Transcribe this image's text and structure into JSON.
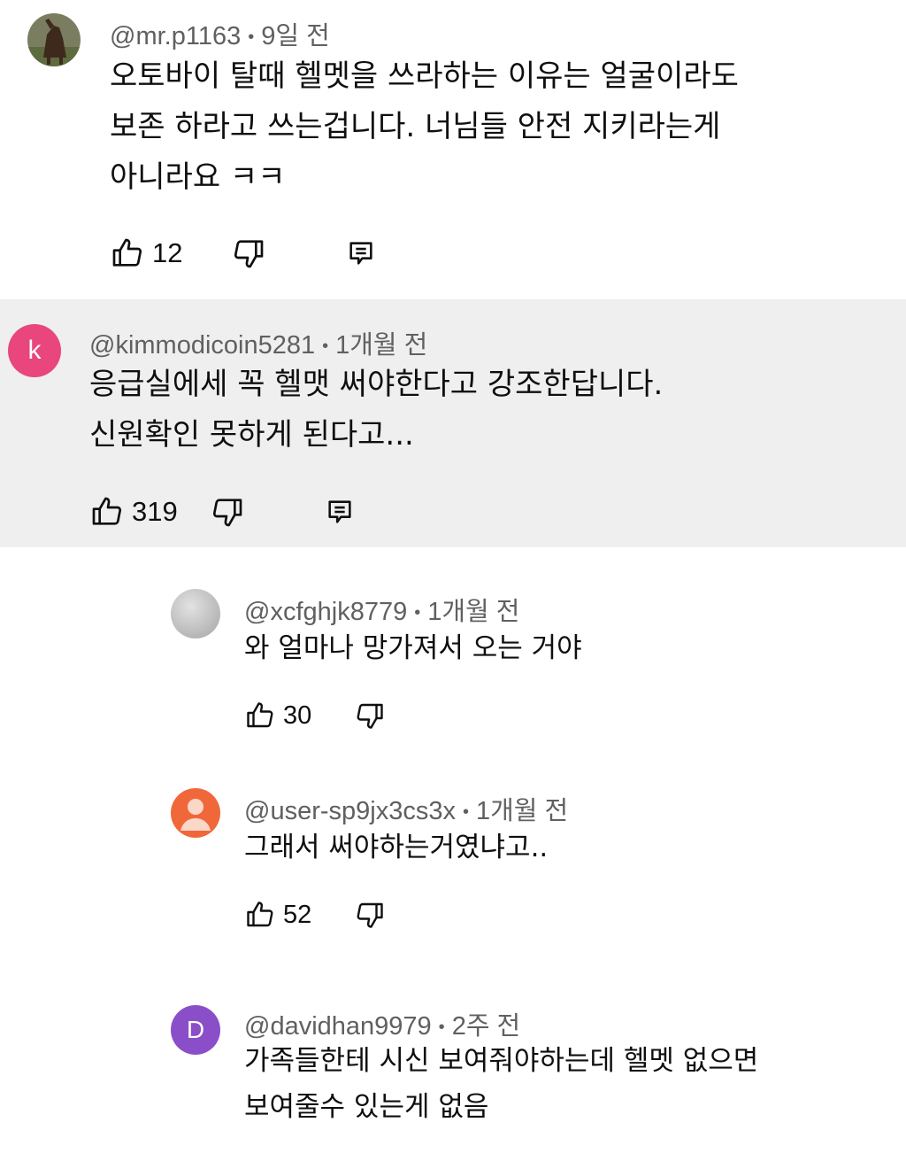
{
  "comments": [
    {
      "author": "@mr.p1163",
      "time": "9일 전",
      "lines": [
        "오토바이 탈때 헬멧을 쓰라하는 이유는 얼굴이라도",
        "보존 하라고 쓰는겁니다. 너님들 안전 지키라는게",
        "아니라요 ㅋㅋ"
      ],
      "likes": "12",
      "avatar": {
        "type": "photo",
        "colors": [
          "#6b6f55",
          "#4a3b2c"
        ]
      }
    },
    {
      "author": "@kimmodicoin5281",
      "time": "1개월 전",
      "lines": [
        "응급실에세 꼭 헬맷 써야한다고 강조한답니다.",
        "신원확인 못하게 된다고..."
      ],
      "likes": "319",
      "avatar": {
        "type": "letter",
        "letter": "k",
        "color": "#e8467c"
      },
      "highlighted": true
    }
  ],
  "replies": [
    {
      "author": "@xcfghjk8779",
      "time": "1개월 전",
      "lines": [
        "와 얼마나 망가져서 오는 거야"
      ],
      "likes": "30",
      "avatar": {
        "type": "gray",
        "color": "#b8b8b8"
      }
    },
    {
      "author": "@user-sp9jx3cs3x",
      "time": "1개월 전",
      "lines": [
        "그래서 써야하는거였냐고.."
      ],
      "likes": "52",
      "avatar": {
        "type": "default-user",
        "color": "#f0683a"
      }
    },
    {
      "author": "@davidhan9979",
      "time": "2주 전",
      "lines": [
        "가족들한테 시신 보여줘야하는데 헬멧 없으면",
        "보여줄수 있는게 없음"
      ],
      "avatar": {
        "type": "letter",
        "letter": "D",
        "color": "#8a4fc8"
      }
    }
  ],
  "icons": {
    "like": "thumbs-up-icon",
    "dislike": "thumbs-down-icon",
    "reply": "reply-icon"
  }
}
